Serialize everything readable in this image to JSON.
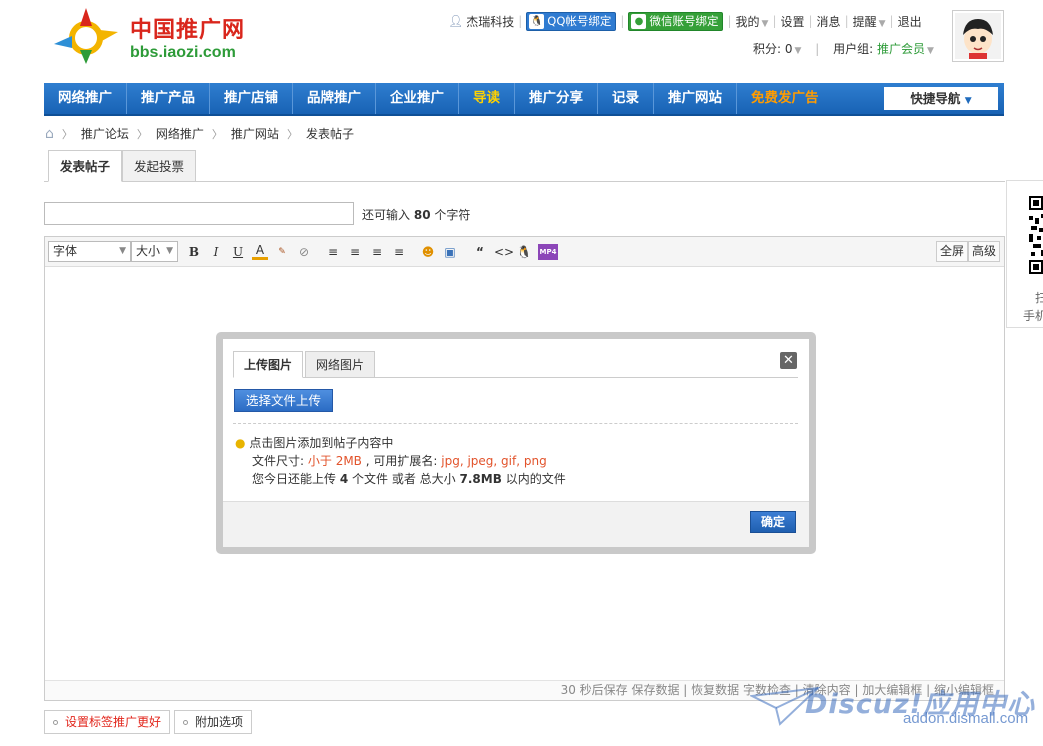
{
  "header": {
    "logo_title": "中国推广网",
    "logo_domain": "bbs.iaozi.com",
    "username": "杰瑞科技",
    "qq_bind": "QQ帐号绑定",
    "wechat_bind": "微信账号绑定",
    "links": {
      "mine": "我的",
      "settings": "设置",
      "messages": "消息",
      "remind": "提醒",
      "logout": "退出"
    },
    "points": "积分: 0",
    "group_label": "用户组:",
    "group_value": "推广会员"
  },
  "nav": {
    "items": [
      "网络推广",
      "推广产品",
      "推广店铺",
      "品牌推广",
      "企业推广",
      "导读",
      "推广分享",
      "记录",
      "推广网站",
      "免费发广告"
    ],
    "quick": "快捷导航"
  },
  "breadcrumb": [
    "推广论坛",
    "网络推广",
    "推广网站",
    "发表帖子"
  ],
  "tabs": [
    "发表帖子",
    "发起投票"
  ],
  "title_field": {
    "hint_prefix": "还可输入",
    "remaining": "80",
    "hint_suffix": "个字符"
  },
  "editor": {
    "font_select": "字体",
    "size_select": "大小",
    "fullscreen": "全屏",
    "advanced": "高级",
    "statusbar": "30 秒后保存 保存数据 | 恢复数据    字数检查 | 清除内容 | 加大编辑框 | 缩小编辑框"
  },
  "dialog": {
    "tabs": [
      "上传图片",
      "网络图片"
    ],
    "upload_button": "选择文件上传",
    "line1": "点击图片添加到帖子内容中",
    "line2_prefix": "文件尺寸:",
    "line2_size": "小于 2MB",
    "line2_mid": ", 可用扩展名:",
    "line2_exts": "jpg, jpeg, gif, png",
    "line3_prefix": "您今日还能上传",
    "line3_count": "4",
    "line3_mid": "个文件 或者 总大小",
    "line3_size": "7.8MB",
    "line3_suffix": "以内的文件",
    "ok": "确定"
  },
  "bottom_options": {
    "tags": "设置标签推广更好",
    "extra": "附加选项"
  },
  "qr_panel": {
    "t1": "扫",
    "t2": "手机"
  },
  "watermark": {
    "brand": "Discuz!应用中心",
    "url": "addon.dismall.com"
  },
  "colors": {
    "nav_blue": "#1f6bbd",
    "accent_red": "#d9261c",
    "brand_green": "#2d9b38",
    "nav_highlight": "#ffd200",
    "nav_orange": "#ff9c00"
  }
}
